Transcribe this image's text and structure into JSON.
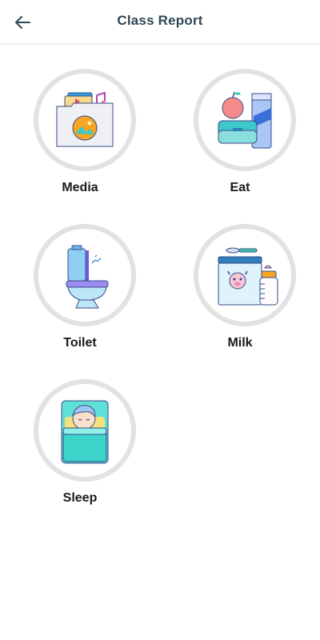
{
  "header": {
    "title": "Class Report",
    "back_icon": "arrow-left-icon"
  },
  "categories": [
    {
      "label": "Media",
      "icon": "media-folder-icon"
    },
    {
      "label": "Eat",
      "icon": "lunchbox-apple-icon"
    },
    {
      "label": "Toilet",
      "icon": "toilet-icon"
    },
    {
      "label": "Milk",
      "icon": "formula-bottle-icon"
    },
    {
      "label": "Sleep",
      "icon": "sleeping-baby-icon"
    }
  ],
  "colors": {
    "header_title": "#2f4858",
    "circle_border": "#e2e2e2",
    "label": "#1a1a1a"
  }
}
